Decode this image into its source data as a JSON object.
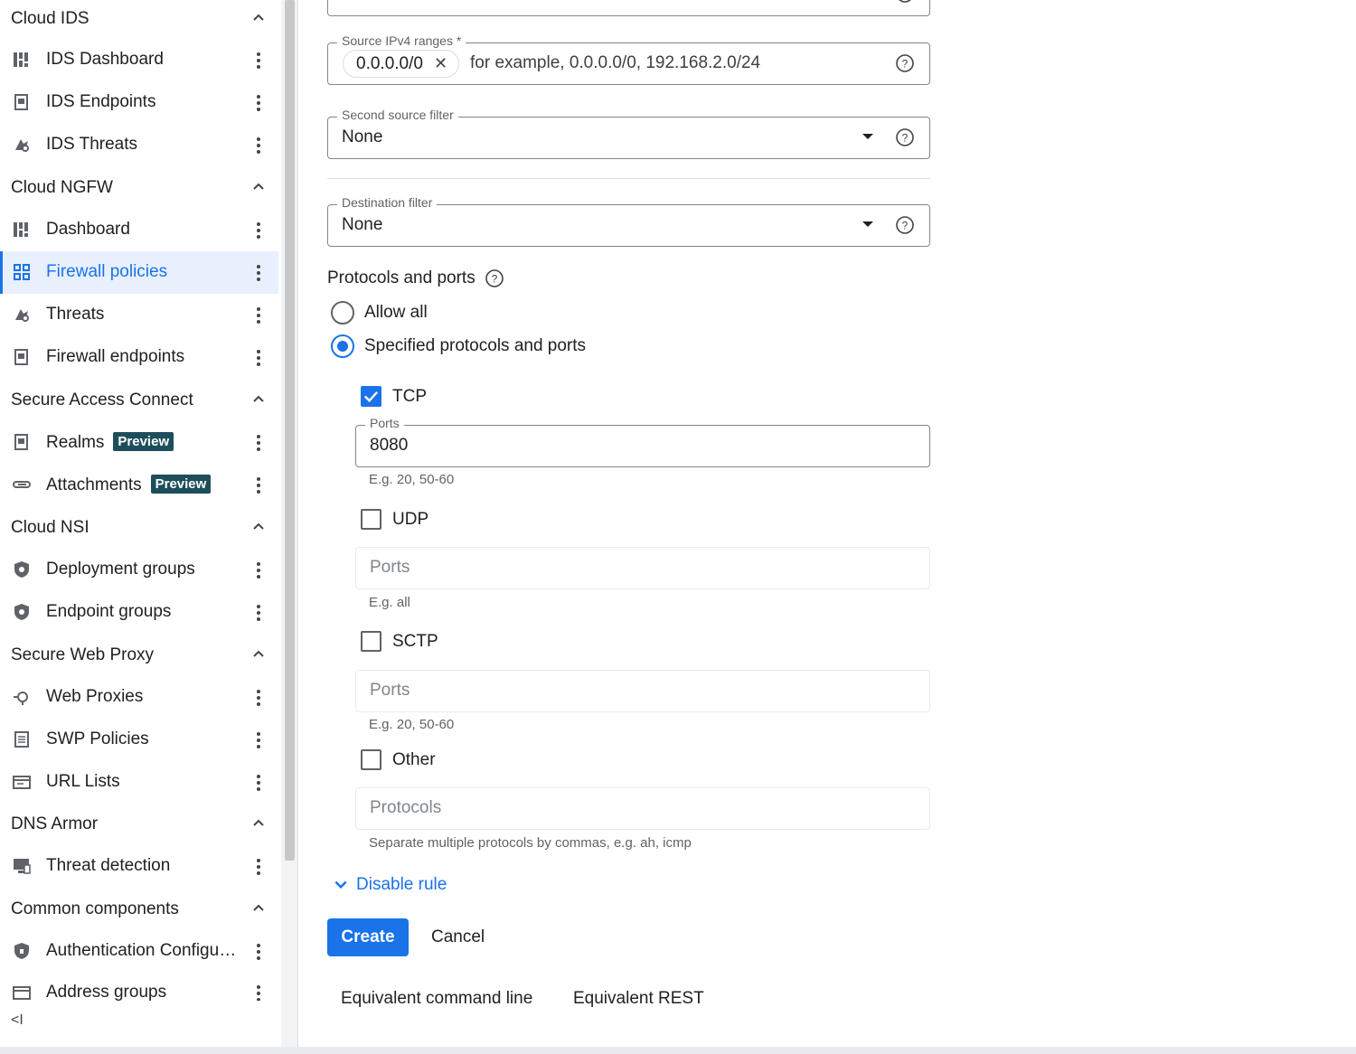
{
  "sidebar": {
    "sections": [
      {
        "title": "Cloud IDS",
        "items": [
          {
            "label": "IDS Dashboard",
            "icon": "dashboard-icon"
          },
          {
            "label": "IDS Endpoints",
            "icon": "endpoint-icon"
          },
          {
            "label": "IDS Threats",
            "icon": "threats-icon"
          }
        ]
      },
      {
        "title": "Cloud NGFW",
        "items": [
          {
            "label": "Dashboard",
            "icon": "dashboard-icon"
          },
          {
            "label": "Firewall policies",
            "icon": "firewall-grid-icon",
            "active": true
          },
          {
            "label": "Threats",
            "icon": "threats-icon"
          },
          {
            "label": "Firewall endpoints",
            "icon": "endpoint-icon"
          }
        ]
      },
      {
        "title": "Secure Access Connect",
        "items": [
          {
            "label": "Realms",
            "icon": "endpoint-icon",
            "badge": "Preview"
          },
          {
            "label": "Attachments",
            "icon": "attachment-icon",
            "badge": "Preview"
          }
        ]
      },
      {
        "title": "Cloud NSI",
        "items": [
          {
            "label": "Deployment groups",
            "icon": "shield-icon"
          },
          {
            "label": "Endpoint groups",
            "icon": "shield-icon"
          }
        ]
      },
      {
        "title": "Secure Web Proxy",
        "items": [
          {
            "label": "Web Proxies",
            "icon": "proxy-icon"
          },
          {
            "label": "SWP Policies",
            "icon": "policy-list-icon"
          },
          {
            "label": "URL Lists",
            "icon": "url-list-icon"
          }
        ]
      },
      {
        "title": "DNS Armor",
        "items": [
          {
            "label": "Threat detection",
            "icon": "monitor-icon"
          }
        ]
      },
      {
        "title": "Common components",
        "items": [
          {
            "label": "Authentication Configu…",
            "icon": "auth-shield-icon"
          },
          {
            "label": "Address groups",
            "icon": "url-list-icon"
          }
        ]
      }
    ],
    "collapse_glyph": "<I"
  },
  "form": {
    "source_ranges": {
      "label": "Source IPv4 ranges *",
      "chip": "0.0.0.0/0",
      "placeholder": "for example, 0.0.0.0/0, 192.168.2.0/24"
    },
    "second_source": {
      "label": "Second source filter",
      "value": "None"
    },
    "destination": {
      "label": "Destination filter",
      "value": "None"
    },
    "protocols": {
      "title": "Protocols and ports",
      "allow_all": "Allow all",
      "specified": "Specified protocols and ports",
      "selected": "specified",
      "tcp": {
        "label": "TCP",
        "checked": true,
        "ports_label": "Ports",
        "ports_value": "8080",
        "hint": "E.g. 20, 50-60"
      },
      "udp": {
        "label": "UDP",
        "checked": false,
        "placeholder": "Ports",
        "hint": "E.g. all"
      },
      "sctp": {
        "label": "SCTP",
        "checked": false,
        "placeholder": "Ports",
        "hint": "E.g. 20, 50-60"
      },
      "other": {
        "label": "Other",
        "checked": false,
        "placeholder": "Protocols",
        "hint": "Separate multiple protocols by commas, e.g. ah, icmp"
      }
    },
    "disable_rule": "Disable rule",
    "create": "Create",
    "cancel": "Cancel",
    "equiv_cli": "Equivalent command line",
    "equiv_rest": "Equivalent REST"
  },
  "colors": {
    "accent": "#1a73e8",
    "active_bg": "#e8f0fe",
    "badge_bg": "#1e4e5b"
  }
}
